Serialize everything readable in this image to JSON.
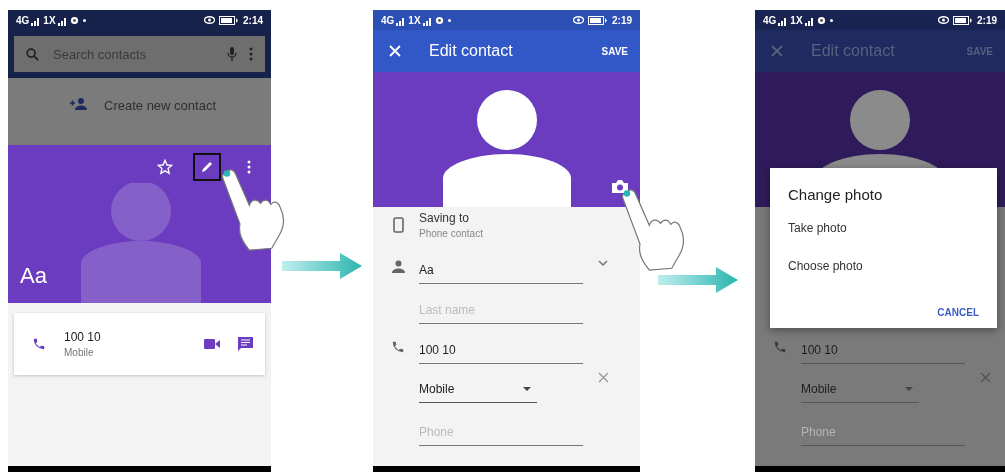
{
  "screens": [
    {
      "kind": "contact_view",
      "status_bar": {
        "networks": [
          "4G",
          "1X"
        ],
        "time": "2:14"
      },
      "search": {
        "placeholder": "Search contacts"
      },
      "create_contact": "Create new contact",
      "starred": false,
      "edit_highlighted": true,
      "contact_name": "Aa",
      "phone_card": {
        "number": "100 10",
        "type": "Mobile"
      },
      "pointer": true
    },
    {
      "kind": "edit_contact",
      "dimmed": false,
      "status_bar": {
        "networks": [
          "4G",
          "1X"
        ],
        "time": "2:19"
      },
      "title": "Edit contact",
      "action": "SAVE",
      "pointer": true,
      "rows": [
        {
          "kind": "account",
          "label": "Saving to",
          "value": "Phone contact"
        },
        {
          "kind": "name",
          "value": "Aa"
        },
        {
          "kind": "text",
          "placeholder": "Last name"
        },
        {
          "kind": "phone",
          "value": "100 10"
        },
        {
          "kind": "type",
          "value": "Mobile"
        },
        {
          "kind": "text",
          "placeholder": "Phone"
        }
      ]
    },
    {
      "kind": "edit_contact",
      "dimmed": true,
      "status_bar": {
        "networks": [
          "4G",
          "1X"
        ],
        "time": "2:19"
      },
      "title": "Edit contact",
      "action": "SAVE",
      "pointer": false,
      "rows": [
        {
          "kind": "phone",
          "value": "100 10"
        },
        {
          "kind": "type",
          "value": "Mobile"
        },
        {
          "kind": "text",
          "placeholder": "Phone"
        }
      ],
      "dialog": {
        "title": "Change photo",
        "options": [
          "Take photo",
          "Choose photo"
        ],
        "button": "CANCEL"
      }
    }
  ]
}
